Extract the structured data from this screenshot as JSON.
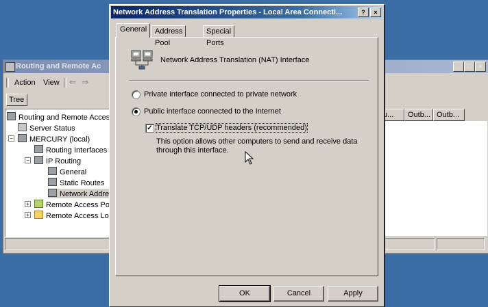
{
  "mmc": {
    "title": "Routing and Remote Ac",
    "menu": {
      "action": "Action",
      "view": "View",
      "back": "⇐",
      "forward": "⇒"
    },
    "tree_tab": "Tree",
    "tree": [
      "Routing and Remote Access",
      "Server Status",
      "MERCURY (local)",
      "Routing Interfaces",
      "IP Routing",
      "General",
      "Static Routes",
      "Network Addres",
      "Remote Access Poli",
      "Remote Access Log"
    ],
    "columns": [
      "u...",
      "Outb...",
      "Outb..."
    ]
  },
  "dialog": {
    "title": "Network Address Translation Properties - Local Area Connecti...",
    "help_btn": "?",
    "close_btn": "×",
    "tabs": [
      "General",
      "Address Pool",
      "Special Ports"
    ],
    "header_label": "Network Address Translation (NAT) Interface",
    "radio_private": "Private interface connected to private network",
    "radio_public": "Public interface connected to the Internet",
    "checkbox_label": "Translate TCP/UDP headers (recommended)",
    "description": "This option allows other computers to send and receive data through this interface.",
    "buttons": {
      "ok": "OK",
      "cancel": "Cancel",
      "apply": "Apply"
    }
  }
}
